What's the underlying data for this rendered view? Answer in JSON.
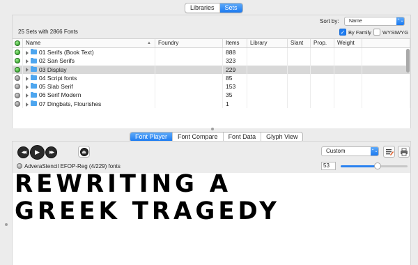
{
  "top_tabs": {
    "items": [
      "Libraries",
      "Sets"
    ],
    "selected": "Sets"
  },
  "summary": "25 Sets with 2866 Fonts",
  "sort": {
    "label": "Sort by:",
    "value": "Name",
    "arrow": "⌃⌄"
  },
  "by_family": {
    "label": "By Family",
    "checked": true,
    "check": "✓"
  },
  "wysiwyg": {
    "label": "WYSIWYG",
    "checked": false
  },
  "columns": [
    "",
    "Name",
    "Foundry",
    "Items",
    "Library",
    "Slant",
    "Prop.",
    "Weight",
    ""
  ],
  "sort_indicator": "▲",
  "rows": [
    {
      "active": true,
      "name": "01 Serifs (Book Text)",
      "items": "888",
      "selected": false
    },
    {
      "active": true,
      "name": "02 San Serifs",
      "items": "323",
      "selected": false
    },
    {
      "active": true,
      "name": "03 Display",
      "items": "229",
      "selected": true
    },
    {
      "active": false,
      "name": "04 Script fonts",
      "items": "85",
      "selected": false
    },
    {
      "active": false,
      "name": "05 Slab Serif",
      "items": "153",
      "selected": false
    },
    {
      "active": false,
      "name": "06 Serif Modern",
      "items": "35",
      "selected": false
    },
    {
      "active": false,
      "name": "07 Dingbats, Flourishes",
      "items": "1",
      "selected": false
    }
  ],
  "bottom_tabs": {
    "items": [
      "Font Player",
      "Font Compare",
      "Font Data",
      "Glyph View"
    ],
    "selected": "Font Player"
  },
  "transport": {
    "rewind_icon": "◀◀",
    "play_icon": "▶",
    "forward_icon": "▶▶",
    "eject_icon": "⏏"
  },
  "preview_size_menu": {
    "value": "Custom",
    "arrow": "⌃⌄"
  },
  "size_value": "53",
  "size_level": 0.55,
  "current_font": "AdveraStencil EFOP-Reg (4/229) fonts",
  "preview_lines": [
    "REWRITING A",
    "GREEK TRAGEDY"
  ]
}
